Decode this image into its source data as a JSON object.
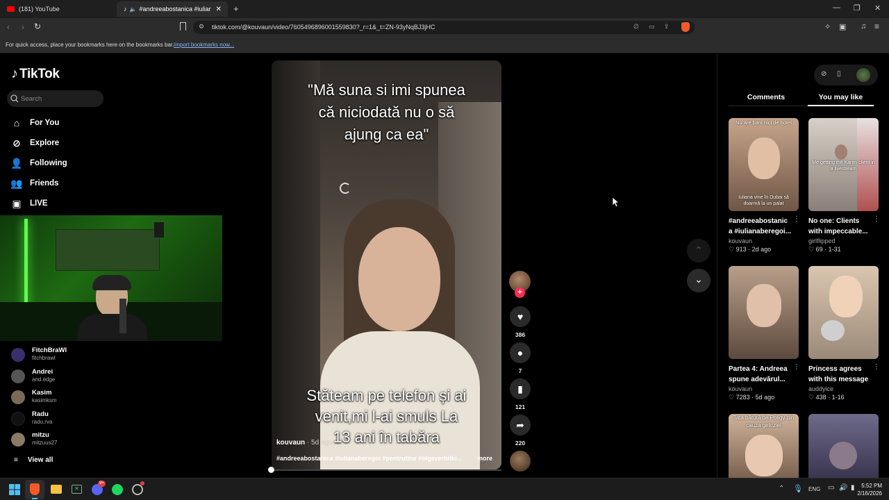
{
  "browser": {
    "tabs": [
      {
        "label": "(181) YouTube",
        "active": false
      },
      {
        "label": "#andreeabostanica #iulianab",
        "active": true
      }
    ],
    "new_tab": "+",
    "url": "tiktok.com/@kouvaun/video/7605496896001559830?_r=1&_t=ZN-93yNqBJ3jHC",
    "bookmarks_text": "For quick access, place your bookmarks here on the bookmarks bar.",
    "bookmarks_link": "Import bookmarks now..."
  },
  "tiktok": {
    "logo": "TikTok",
    "search_placeholder": "Search",
    "nav": [
      {
        "label": "For You",
        "icon": "home-icon"
      },
      {
        "label": "Explore",
        "icon": "compass-icon"
      },
      {
        "label": "Following",
        "icon": "following-icon"
      },
      {
        "label": "Friends",
        "icon": "friends-icon"
      },
      {
        "label": "LIVE",
        "icon": "live-icon"
      }
    ],
    "following_accounts": [
      {
        "name": "FitchBraWl",
        "handle": "fitchbrawl",
        "color": "#3b2f6b"
      },
      {
        "name": "Andrei",
        "handle": "and.edge",
        "color": "#555555"
      },
      {
        "name": "Kasim",
        "handle": "kasimksm",
        "color": "#7a6a58"
      },
      {
        "name": "Radu",
        "handle": "radu.rva",
        "color": "#111111"
      },
      {
        "name": "mitzu",
        "handle": "mitzuus27",
        "color": "#8a7a68"
      }
    ],
    "view_all": "View all"
  },
  "video": {
    "caption_top": "\"Mă suna si imi spunea că niciodată nu o să ajung ca ea\"",
    "caption_bottom": "Stăteam pe telefon și ai venit,mi l-ai smuls La 13 ani în tabăra",
    "author": "kouvaun",
    "age": "· 5d ago",
    "hashtags": "#andreeabostanica #iulianaberegoi #pentrutine #olgaverbitki...",
    "more": "more",
    "likes": "386",
    "comments": "7",
    "saves": "121",
    "shares": "220"
  },
  "right_panel": {
    "tabs": [
      "Comments",
      "You may like"
    ],
    "active_tab": "You may like",
    "cards": [
      {
        "title": "#andreeabostanic a #iulianaberegoi...",
        "author": "kouvaun",
        "likes": "913",
        "age": "2d ago",
        "overlay_top": "Nu are bani nici de hotel",
        "overlay_bottom": "Iuliana vine în Dubai să doarmă la un palat",
        "tone": [
          "#c7a58b",
          "#6f5646"
        ]
      },
      {
        "title": "No one: Clients with impeccable...",
        "author": "girlflipped",
        "likes": "69",
        "age": "1-31",
        "overlay_top": "",
        "overlay_bottom": "Me getting the Karen client in a livestream",
        "tone": [
          "#d8d0c8",
          "#8a7f78"
        ]
      },
      {
        "title": "Partea 4: Andreea spune adevărul...",
        "author": "kouvaun",
        "likes": "7283",
        "age": "5d ago",
        "overlay_top": "",
        "overlay_bottom": "",
        "tone": [
          "#b89f8a",
          "#5d4a3e"
        ]
      },
      {
        "title": "Princess agrees with this message",
        "author": "auddyice",
        "likes": "438",
        "age": "1-16",
        "overlay_top": "",
        "overlay_bottom": "",
        "tone": [
          "#d9c6b0",
          "#9b8a78"
        ]
      },
      {
        "title": "",
        "author": "",
        "likes": "",
        "age": "",
        "overlay_top": "Tata bătută de Poligy din cauza geloziei",
        "overlay_bottom": "",
        "tone": [
          "#d0b39a",
          "#7b6250"
        ]
      },
      {
        "title": "",
        "author": "",
        "likes": "",
        "age": "",
        "overlay_top": "",
        "overlay_bottom": "",
        "tone": [
          "#6e6a8a",
          "#3a3650"
        ]
      }
    ]
  },
  "taskbar": {
    "lang": "ENG",
    "time": "5:52 PM",
    "date": "2/16/2026",
    "discord_badge": "9+"
  }
}
